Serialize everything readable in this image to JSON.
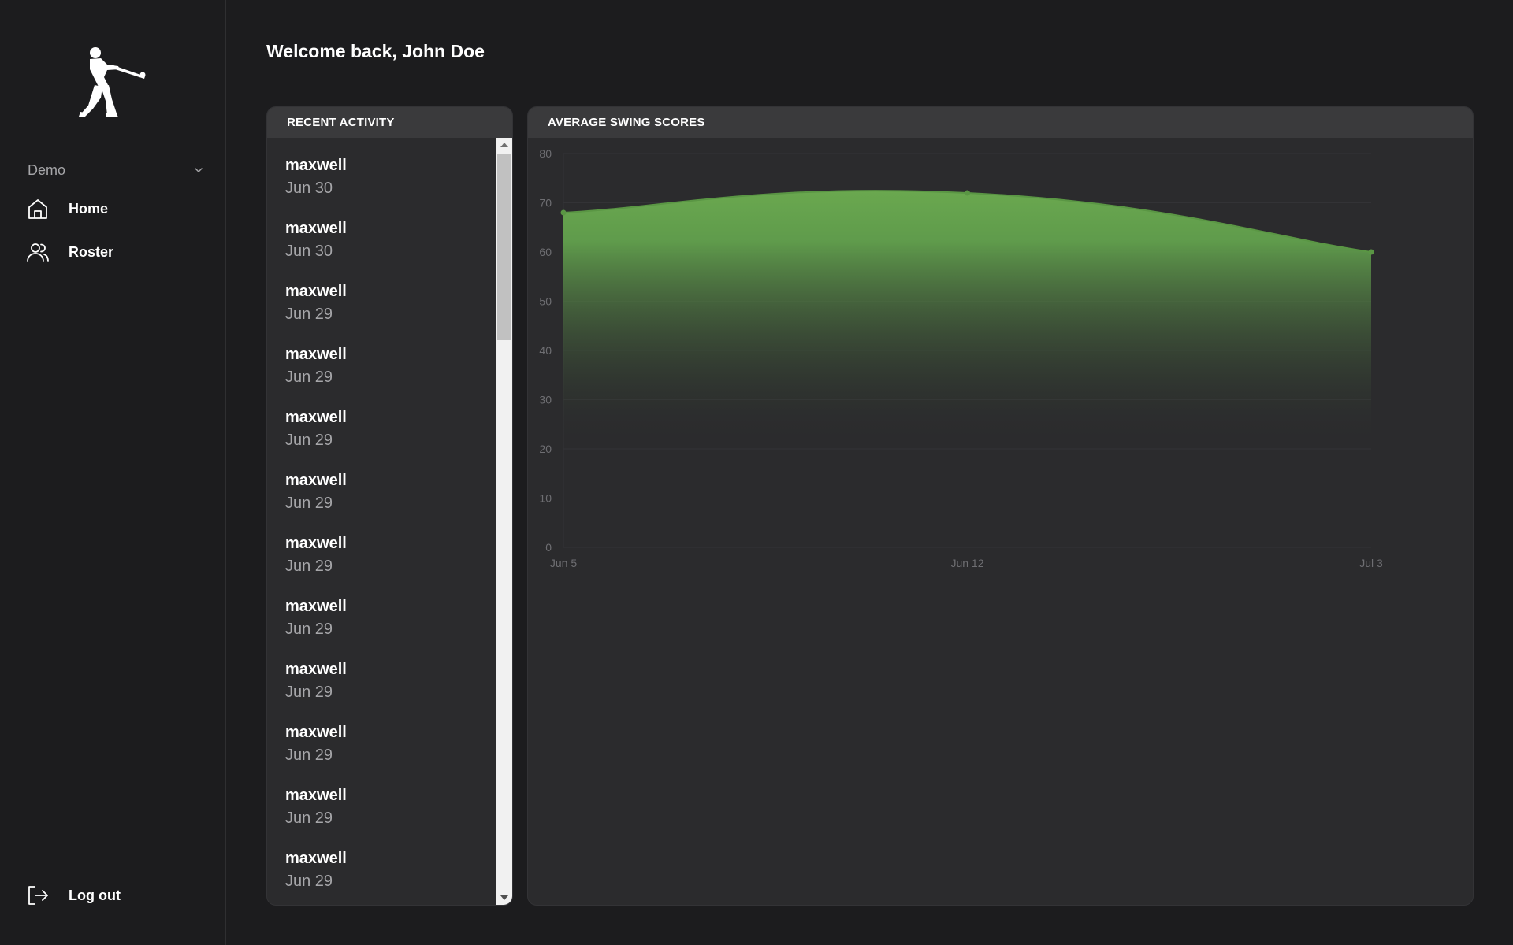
{
  "sidebar": {
    "team_select": {
      "value": "Demo"
    },
    "nav": [
      {
        "label": "Home",
        "icon": "home-icon"
      },
      {
        "label": "Roster",
        "icon": "users-icon"
      }
    ],
    "logout": {
      "label": "Log out",
      "icon": "logout-icon"
    }
  },
  "header": {
    "welcome": "Welcome back, John Doe"
  },
  "recent_activity": {
    "title": "RECENT ACTIVITY",
    "items": [
      {
        "name": "maxwell",
        "date": "Jun 30"
      },
      {
        "name": "maxwell",
        "date": "Jun 30"
      },
      {
        "name": "maxwell",
        "date": "Jun 29"
      },
      {
        "name": "maxwell",
        "date": "Jun 29"
      },
      {
        "name": "maxwell",
        "date": "Jun 29"
      },
      {
        "name": "maxwell",
        "date": "Jun 29"
      },
      {
        "name": "maxwell",
        "date": "Jun 29"
      },
      {
        "name": "maxwell",
        "date": "Jun 29"
      },
      {
        "name": "maxwell",
        "date": "Jun 29"
      },
      {
        "name": "maxwell",
        "date": "Jun 29"
      },
      {
        "name": "maxwell",
        "date": "Jun 29"
      },
      {
        "name": "maxwell",
        "date": "Jun 29"
      }
    ]
  },
  "swing_scores": {
    "title": "AVERAGE SWING SCORES"
  },
  "colors": {
    "accent_green": "#6aa84f",
    "background": "#1c1c1e",
    "panel": "#2b2b2d",
    "panel_header": "#3a3a3c"
  },
  "chart_data": {
    "type": "area",
    "title": "AVERAGE SWING SCORES",
    "x": [
      "Jun 5",
      "Jun 12",
      "Jul 3"
    ],
    "series": [
      {
        "values": [
          68,
          72,
          60
        ]
      }
    ],
    "ylim": [
      0,
      80
    ],
    "yticks": [
      0,
      10,
      20,
      30,
      40,
      50,
      60,
      70,
      80
    ],
    "xticks": [
      "Jun 5",
      "Jun 12",
      "Jul 3"
    ],
    "grid": true,
    "xlabel": "",
    "ylabel": ""
  }
}
